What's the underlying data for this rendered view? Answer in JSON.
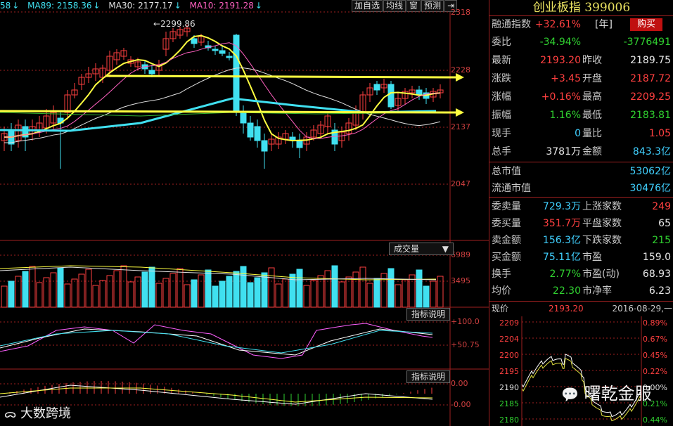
{
  "ma_bar": {
    "ma5_tail": "58",
    "ma89": "MA89: 2158.36",
    "ma30": "MA30: 2177.17",
    "ma10": "MA10: 2191.28",
    "down_arrow": "↓"
  },
  "toolbar": {
    "add_fav": "加自选",
    "avg_line": "均线",
    "window": "窗",
    "forecast": "预测",
    "next": "⇥"
  },
  "axis": {
    "price_ticks": [
      "2318",
      "2228",
      "2137",
      "2047"
    ],
    "volume_ticks": [
      "6989",
      "3495"
    ],
    "ind1_ticks": [
      "100.0",
      "50.75"
    ],
    "ind2_ticks": [
      "0.00",
      "0.00"
    ],
    "peak_label": "2299.86"
  },
  "volume_panel": {
    "dropdown_label": "成交量"
  },
  "indicator1": {
    "btn": "指标说明"
  },
  "indicator2": {
    "btn": "指标说明"
  },
  "quote": {
    "title": "创业板指 399006",
    "rows": [
      {
        "l1": "融通指数",
        "v1": "+32.61%",
        "v1b": "[年]",
        "buy": "购买"
      },
      {
        "l1": "委比",
        "v1": "-34.94%",
        "v2": "-3776491"
      },
      {
        "l1": "最新",
        "v1": "2193.20",
        "l2": "昨收",
        "v2": "2189.75"
      },
      {
        "l1": "涨跌",
        "v1": "+3.45",
        "l2": "开盘",
        "v2": "2187.72"
      },
      {
        "l1": "涨幅",
        "v1": "+0.16%",
        "l2": "最高",
        "v2": "2209.25"
      },
      {
        "l1": "振幅",
        "v1": "1.16%",
        "l2": "最低",
        "v2": "2183.81"
      },
      {
        "l1": "现手",
        "v1": "0",
        "l2": "量比",
        "v2": "1.05"
      },
      {
        "l1": "总手",
        "v1": "3781万",
        "l2": "金额",
        "v2": "843.3亿"
      },
      {
        "l1": "总市值",
        "v2": "53062亿"
      },
      {
        "l1": "流通市值",
        "v2": "30476亿"
      },
      {
        "l1": "委卖量",
        "v1": "729.3万",
        "l2": "上涨家数",
        "v2": "249"
      },
      {
        "l1": "委买量",
        "v1": "351.7万",
        "l2": "平盘家数",
        "v2": "65"
      },
      {
        "l1": "卖金额",
        "v1": "156.3亿",
        "l2": "下跌家数",
        "v2": "215"
      },
      {
        "l1": "买金额",
        "v1": "75.11亿",
        "l2": "市盈",
        "v2": "159.0"
      },
      {
        "l1": "换手",
        "v1": "2.77%",
        "l2": "市盈(动)",
        "v2": "68.93"
      },
      {
        "l1": "均价",
        "v1": "22.30",
        "l2": "市净率",
        "v2": "6.23"
      }
    ]
  },
  "mini": {
    "label": "现价",
    "price": "2193.20",
    "date": "2016-08-29,一",
    "left_ticks": [
      "2209",
      "2204",
      "2200",
      "2195",
      "2190",
      "2185",
      "2180"
    ],
    "right_ticks": [
      "0.89%",
      "0.67%",
      "0.45%",
      "0.22%",
      "0.00%",
      "0.21%",
      "0.44%"
    ]
  },
  "watermarks": {
    "left": "大数跨境",
    "right": "曙乾金服"
  },
  "colors": {
    "up": "#ff4040",
    "down": "#40e0f0",
    "ma_yellow": "#ffff40",
    "panel_border": "#a02020"
  }
}
